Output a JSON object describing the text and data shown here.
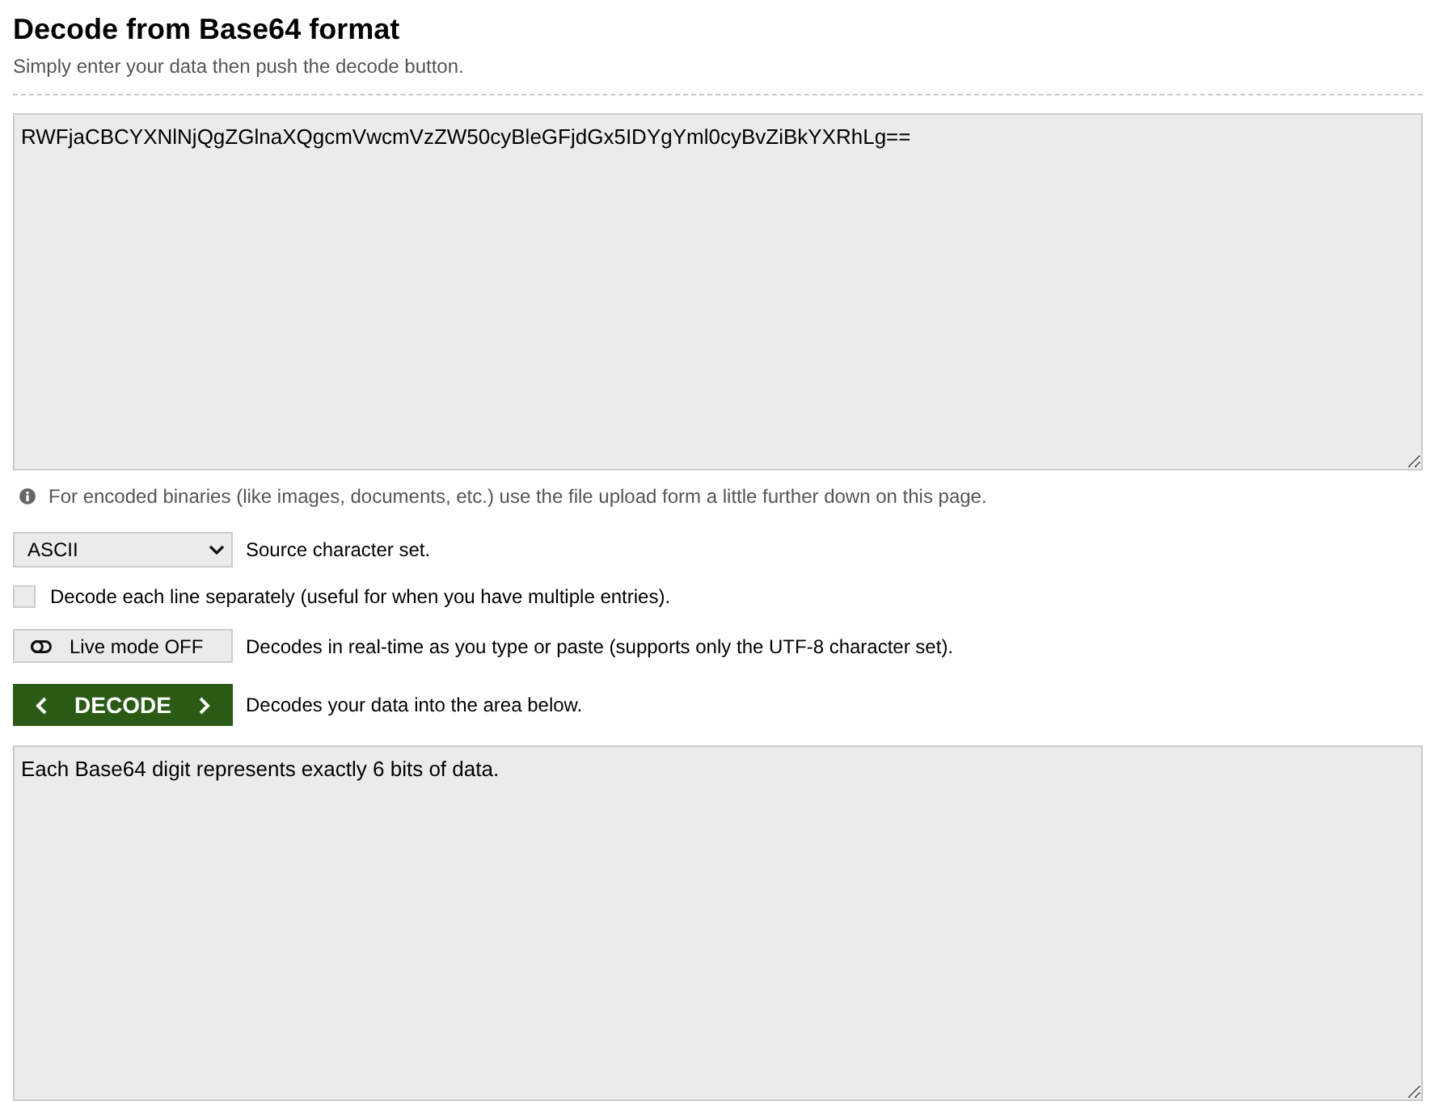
{
  "header": {
    "title": "Decode from Base64 format",
    "subtitle": "Simply enter your data then push the decode button."
  },
  "input": {
    "value": "RWFjaCBCYXNlNjQgZGlnaXQgcmVwcmVzZW50cyBleGFjdGx5IDYgYml0cyBvZiBkYXRhLg=="
  },
  "info_note": "For encoded binaries (like images, documents, etc.) use the file upload form a little further down on this page.",
  "charset": {
    "value": "ASCII",
    "description": "Source character set."
  },
  "decode_lines": {
    "label": "Decode each line separately (useful for when you have multiple entries).",
    "checked": false
  },
  "live_mode": {
    "button": "Live mode OFF",
    "on": false,
    "description": "Decodes in real-time as you type or paste (supports only the UTF-8 character set)."
  },
  "decode_button": {
    "label": "DECODE",
    "description": "Decodes your data into the area below."
  },
  "output": {
    "value": "Each Base64 digit represents exactly 6 bits of data."
  }
}
